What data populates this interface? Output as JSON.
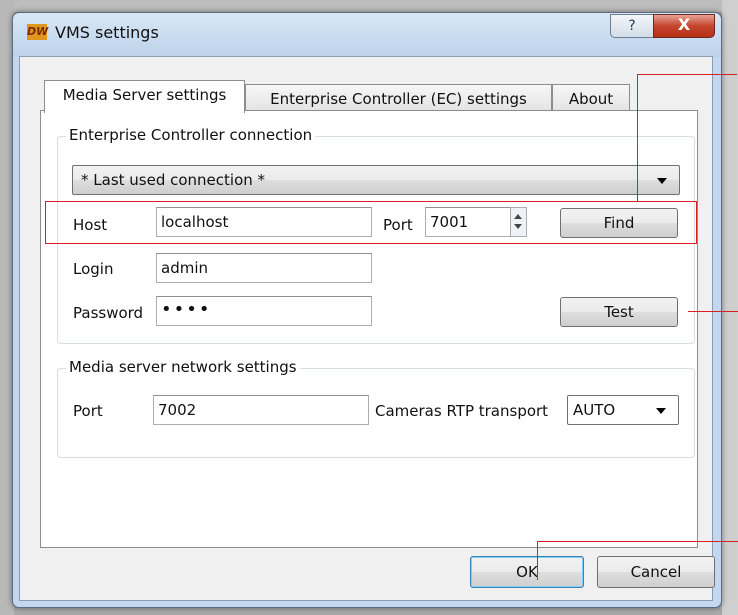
{
  "window": {
    "title": "VMS settings",
    "logo_text": "DW",
    "help_glyph": "?",
    "close_glyph": "X"
  },
  "tabs": [
    {
      "label": "Media Server settings",
      "active": true
    },
    {
      "label": "Enterprise Controller (EC) settings",
      "active": false
    },
    {
      "label": "About",
      "active": false
    }
  ],
  "ec_connection": {
    "group_title": "Enterprise Controller connection",
    "connection_select": "* Last used connection *",
    "host_label": "Host",
    "host_value": "localhost",
    "port_label": "Port",
    "port_value": "7001",
    "find_button": "Find",
    "login_label": "Login",
    "login_value": "admin",
    "password_label": "Password",
    "password_value": "••••",
    "test_button": "Test"
  },
  "network": {
    "group_title": "Media server network settings",
    "port_label": "Port",
    "port_value": "7002",
    "rtp_label": "Cameras RTP transport",
    "rtp_value": "AUTO"
  },
  "footer": {
    "ok_button": "OK",
    "cancel_button": "Cancel"
  },
  "colors": {
    "annotation": "#d82020",
    "titlebar": "#c3d7ee"
  },
  "icons": {
    "app_logo": "dw-logo-icon",
    "help": "help-icon",
    "close": "close-icon"
  }
}
